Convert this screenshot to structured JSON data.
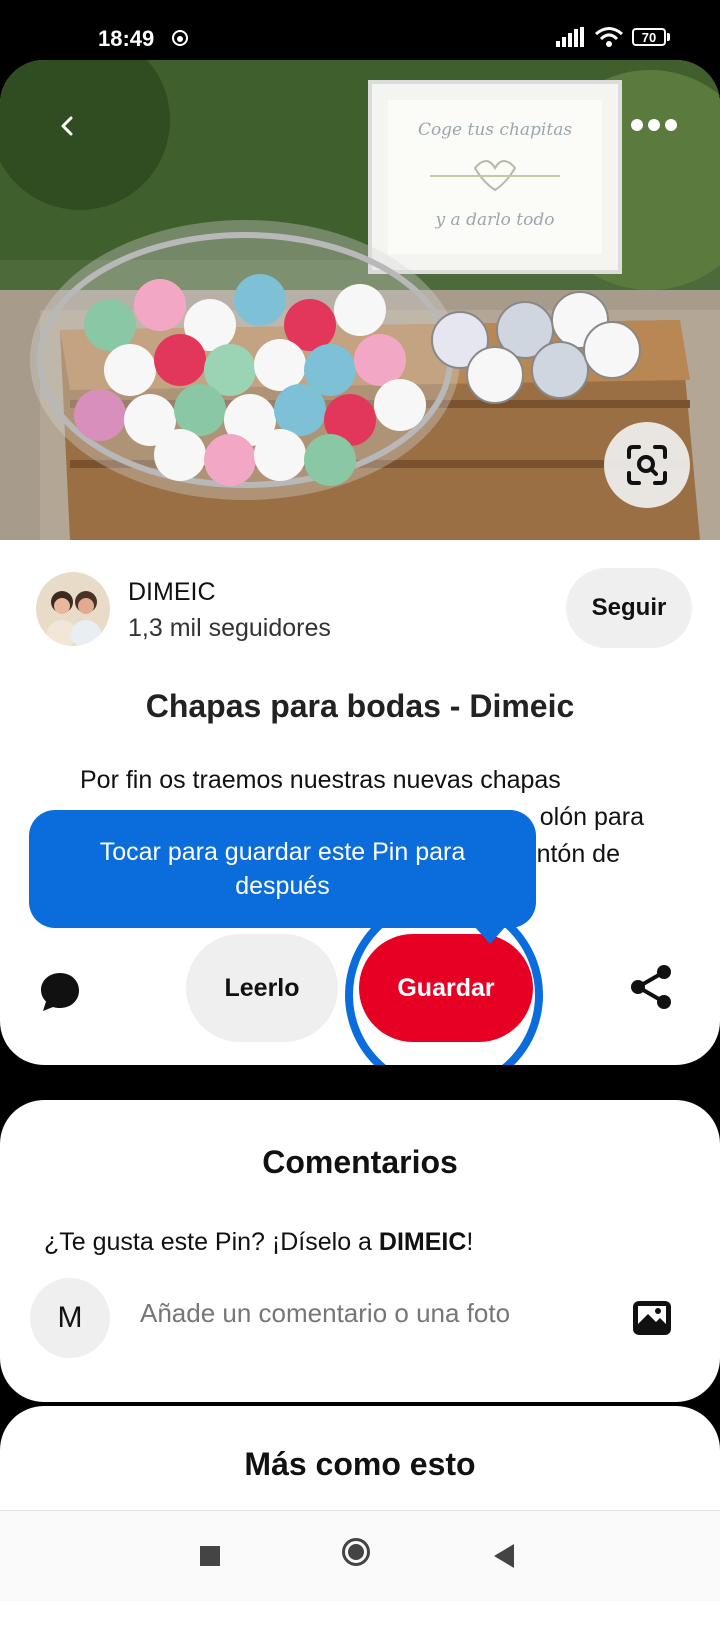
{
  "status_bar": {
    "time": "18:49",
    "battery": "70",
    "icons": [
      "notification-icon",
      "signal-icon",
      "wifi-icon",
      "battery-icon"
    ]
  },
  "pin": {
    "image_alt": "Cesta con chapas para bodas",
    "image_sign_line1": "Coge tus chapitas",
    "image_sign_line2": "y a darlo todo",
    "creator": {
      "name": "DIMEIC",
      "followers": "1,3 mil seguidores",
      "follow_label": "Seguir"
    },
    "title": "Chapas para bodas - Dimeic",
    "description": "Por fin os traemos nuestras nuevas chapas",
    "description_line2_end": "olón para",
    "description_line3_end": "ntón de"
  },
  "actions": {
    "read_label": "Leerlo",
    "save_label": "Guardar"
  },
  "tooltip": {
    "text": "Tocar para guardar este Pin para después"
  },
  "comments": {
    "title": "Comentarios",
    "prompt_prefix": "¿Te gusta este Pin? ¡Díselo a ",
    "prompt_name": "DIMEIC",
    "prompt_suffix": "!",
    "user_initial": "M",
    "input_placeholder": "Añade un comentario o una foto"
  },
  "more": {
    "title": "Más como esto"
  },
  "colors": {
    "save_red": "#e60023",
    "tooltip_blue": "#0a6ddb"
  }
}
